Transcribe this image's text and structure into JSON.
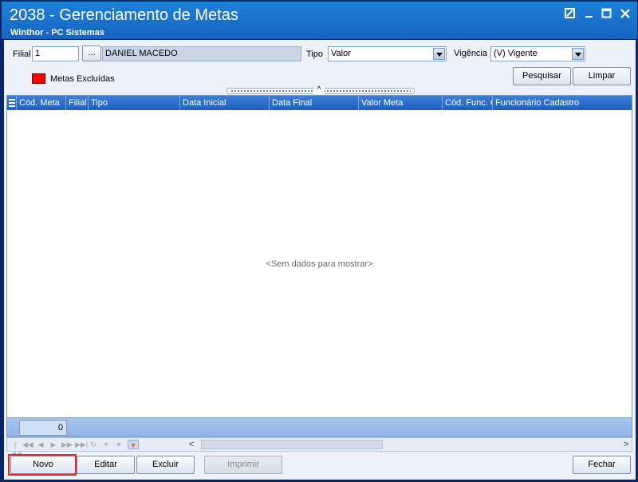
{
  "window": {
    "title": "2038 - Gerenciamento de Metas",
    "subtitle": "Winthor - PC Sistemas"
  },
  "filters": {
    "filial_label": "Filial",
    "filial_value": "1",
    "filial_lookup_label": "...",
    "filial_name": "DANIEL MACEDO",
    "tipo_label": "Tipo",
    "tipo_value": "Valor",
    "vigencia_label": "Vigência",
    "vigencia_value": "(V) Vigente",
    "legend_label": "Metas Excluídas",
    "search_button": "Pesquisar",
    "clear_button": "Limpar"
  },
  "grid": {
    "columns": [
      "Cód. Meta",
      "Filial",
      "Tipo",
      "Data Inicial",
      "Data Final",
      "Valor Meta",
      "Cód. Func. C",
      "Funcionário Cadastro"
    ],
    "empty_message": "<Sem dados para mostrar>",
    "record_count": "0"
  },
  "actions": {
    "new": "Novo",
    "edit": "Editar",
    "delete": "Excluir",
    "print": "Imprimir",
    "close": "Fechar"
  },
  "colors": {
    "excluded_legend": "#ff0000",
    "highlight": "#e0262a",
    "title_bar": "#1565c0"
  }
}
